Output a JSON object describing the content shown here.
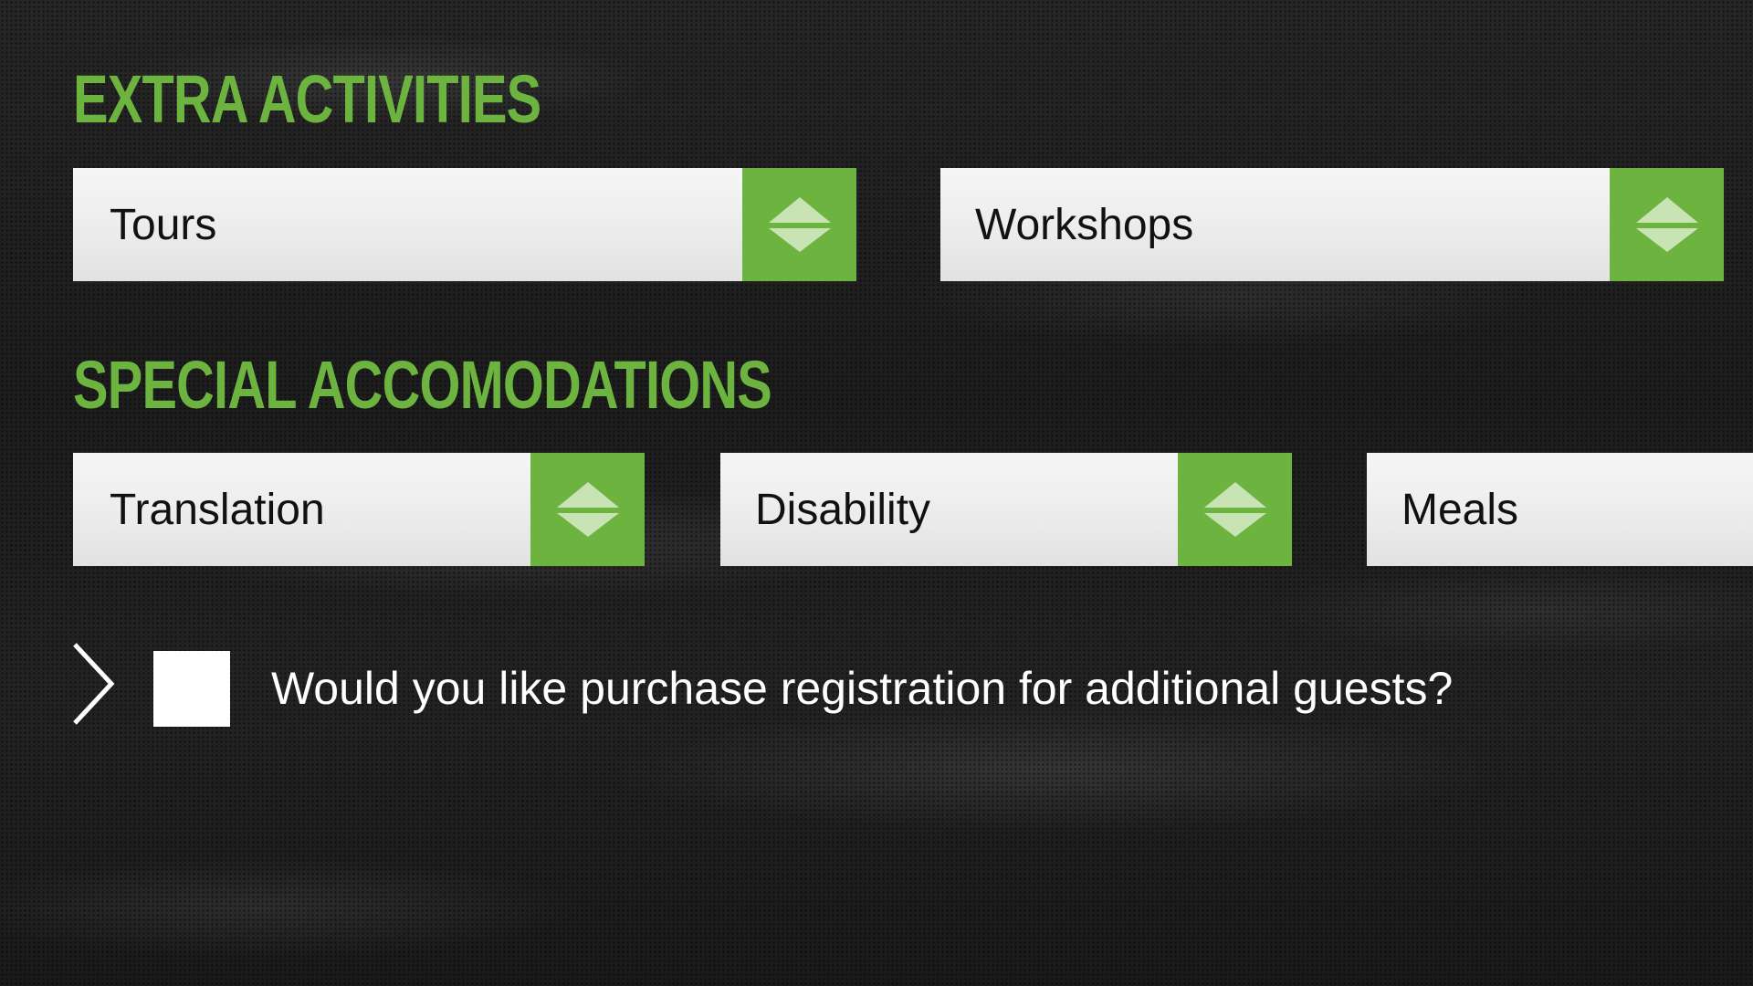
{
  "sections": {
    "extra_activities": {
      "heading": "EXTRA ACTIVITIES",
      "selects": {
        "tours": "Tours",
        "workshops": "Workshops"
      }
    },
    "special_accommodations": {
      "heading": "SPECIAL ACCOMODATIONS",
      "selects": {
        "translation": "Translation",
        "disability": "Disability",
        "meals": "Meals"
      }
    }
  },
  "additional_guests": {
    "question": "Would you like purchase registration for additional guests?",
    "checked": false
  },
  "icons": {
    "dropdown": "up-down-arrows-icon",
    "chevron": "chevron-right-icon"
  },
  "colors": {
    "accent": "#6db33f",
    "arrow_light": "#c8e4b4",
    "background": "#1c1c1c",
    "select_bg": "#efefef",
    "text": "#111111"
  }
}
